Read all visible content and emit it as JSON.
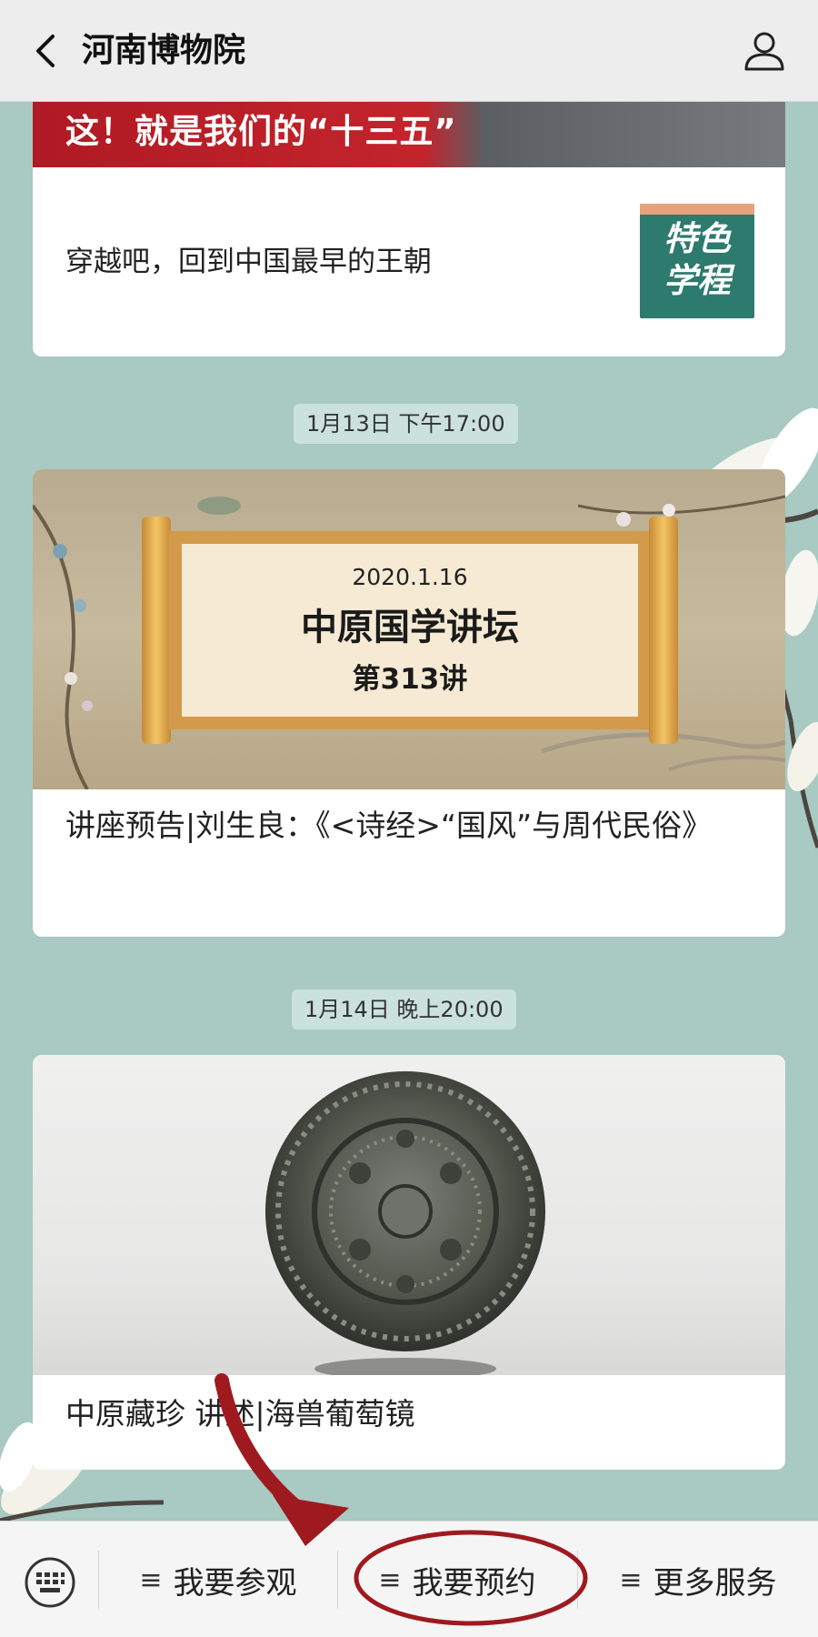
{
  "header": {
    "title": "河南博物院",
    "back_icon": "back-chevron-icon",
    "profile_icon": "person-icon"
  },
  "feed": {
    "card1": {
      "banner_text": "这！就是我们的“十三五”",
      "row_text": "穿越吧，回到中国最早的王朝",
      "thumbnail_text": "特色学程"
    },
    "timestamp1": "1月13日 下午17:00",
    "card2": {
      "image_date": "2020.1.16",
      "image_title": "中原国学讲坛",
      "image_subtitle": "第313讲",
      "text": "讲座预告|刘生良：《<诗经>“国风”与周代民俗》"
    },
    "timestamp2": "1月14日 晚上20:00",
    "card3": {
      "text": "中原藏珍 讲述|海兽葡萄镜"
    }
  },
  "bottom_bar": {
    "keyboard_icon": "keyboard-icon",
    "menu_symbol": "≡",
    "items": [
      {
        "label": "我要参观"
      },
      {
        "label": "我要预约"
      },
      {
        "label": "更多服务"
      }
    ]
  },
  "colors": {
    "background": "#a9c9c3",
    "banner_red": "#c3242c",
    "thumbnail_teal": "#2d7a6e",
    "annotation_red": "#9e1a1f"
  }
}
